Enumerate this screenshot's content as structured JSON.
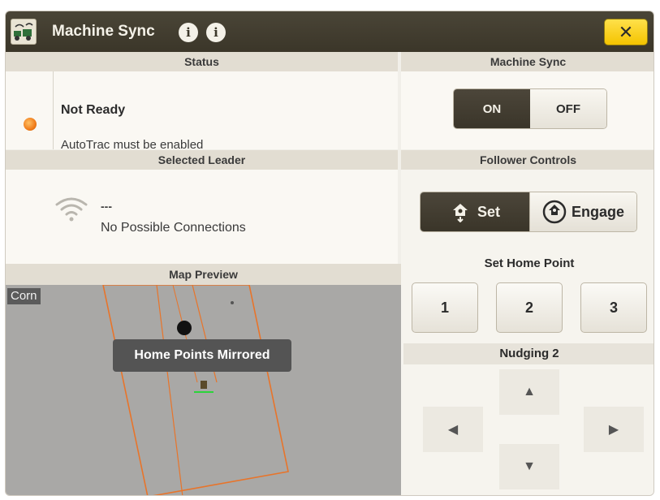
{
  "window": {
    "title": "Machine Sync",
    "close_label": "✕"
  },
  "status": {
    "header": "Status",
    "title": "Not Ready",
    "message": "AutoTrac must be enabled",
    "indicator_color": "#f07c1a"
  },
  "machine_sync": {
    "header": "Machine Sync",
    "on_label": "ON",
    "off_label": "OFF",
    "selected": "ON"
  },
  "leader": {
    "header": "Selected Leader",
    "name": "---",
    "message": "No Possible Connections"
  },
  "follower_controls": {
    "header": "Follower Controls",
    "set_label": "Set",
    "engage_label": "Engage",
    "selected": "Set"
  },
  "home_point": {
    "label": "Set Home Point",
    "buttons": [
      "1",
      "2",
      "3"
    ]
  },
  "nudging": {
    "label": "Nudging 2"
  },
  "map": {
    "header": "Map Preview",
    "crop": "Corn",
    "toast": "Home Points Mirrored",
    "boundary_color": "#e8742a"
  },
  "colors": {
    "titlebar": "#3b3629",
    "accent_yellow": "#f4c400",
    "selected_segment": "#3a3529"
  }
}
